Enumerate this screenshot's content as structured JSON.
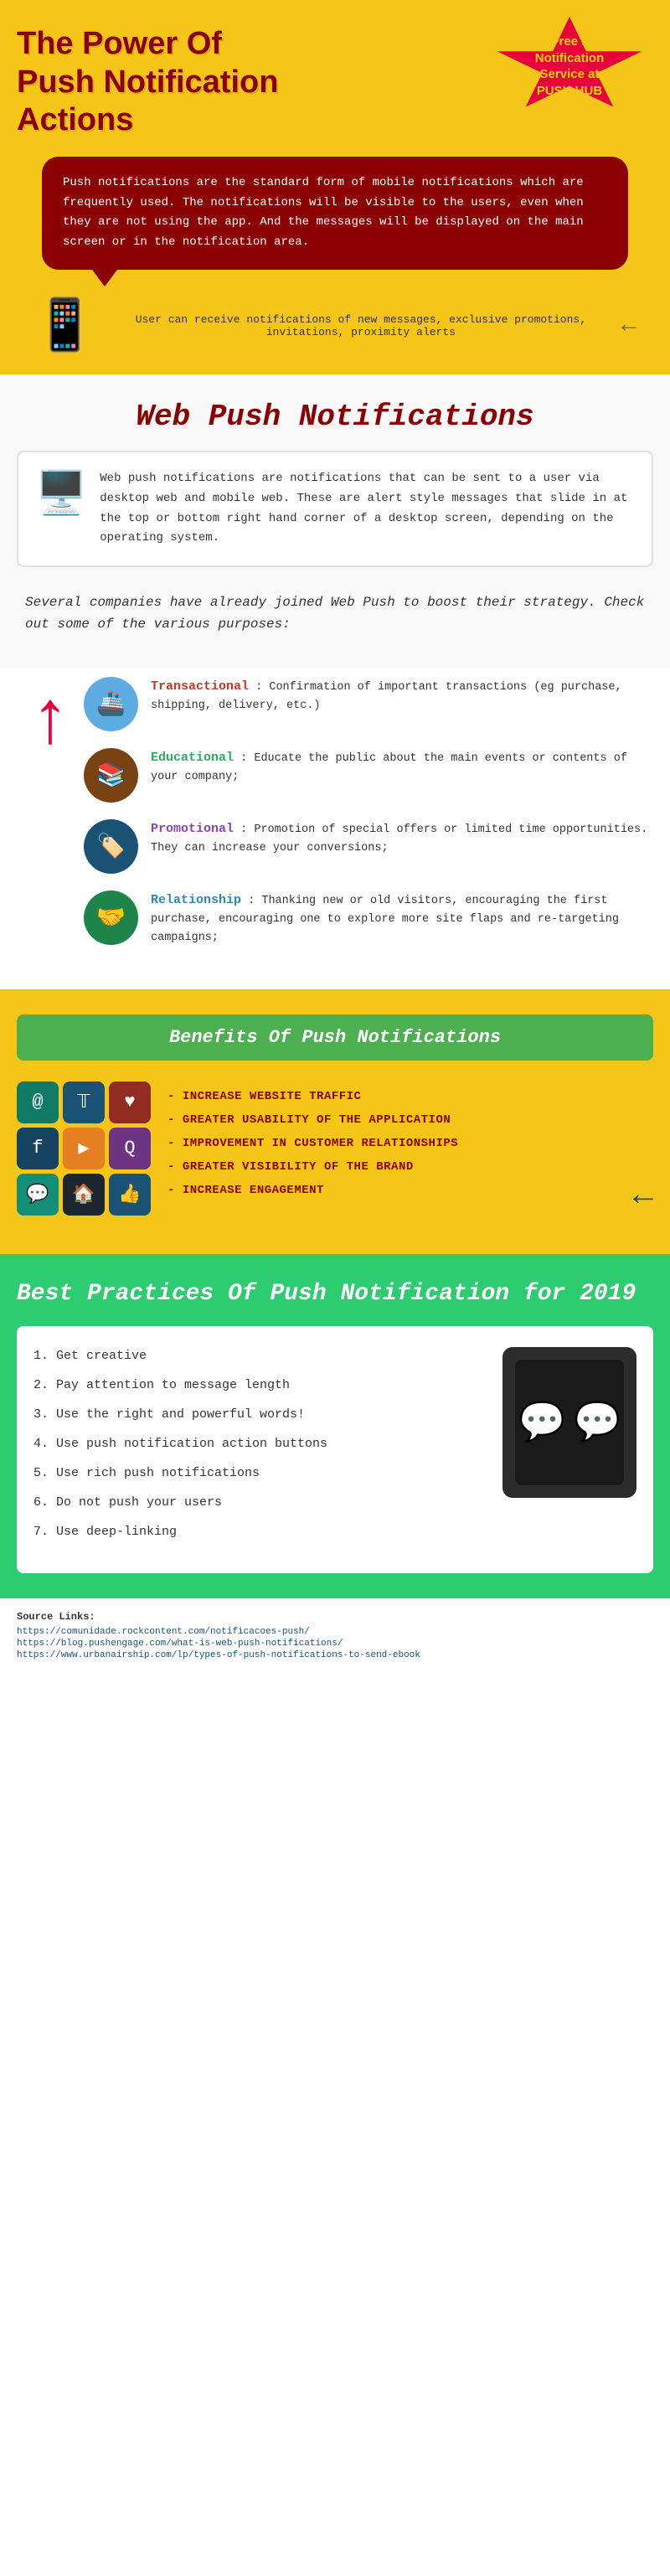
{
  "hero": {
    "title": "The Power Of Push Notification Actions",
    "starburst": {
      "line1": "Get Free Push",
      "line2": "Notification",
      "line3": "Service at",
      "line4": "PUSH HUB"
    },
    "bubble_text": "Push notifications are the standard form of mobile notifications which are frequently used. The notifications will be visible to the users, even when they are not using the app. And the messages will be displayed on the main screen or in the notification area.",
    "phone_caption": "User can receive notifications of new messages, exclusive promotions, invitations, proximity alerts"
  },
  "webpush": {
    "title": "Web Push Notifications",
    "description": "Web push notifications are notifications that can be sent to a user via desktop web and mobile web. These are alert style messages that slide in at the top or bottom right hand corner of a desktop screen, depending on the operating system.",
    "strategy_text": "Several companies have already joined Web Push to boost their strategy. Check out some of the various purposes:"
  },
  "purposes": [
    {
      "label": "Transactional",
      "label_color": "transactional",
      "text": ": Confirmation of important transactions (eg purchase, shipping, delivery, etc.)",
      "icon": "🚢"
    },
    {
      "label": "Educational",
      "label_color": "educational",
      "text": ": Educate the public about the main events or contents of your company;",
      "icon": "📚"
    },
    {
      "label": "Promotional",
      "label_color": "promotional",
      "text": ": Promotion of special offers or limited time opportunities. They can increase your conversions;",
      "icon": "🏷️"
    },
    {
      "label": "Relationship",
      "label_color": "relationship",
      "text": ": Thanking new or old visitors, encouraging the first purchase, encouraging one to explore more site flaps and re-targeting campaigns;",
      "icon": "🤝"
    }
  ],
  "benefits": {
    "title": "Benefits Of Push Notifications",
    "items": [
      "Increase Website Traffic",
      "Greater Usability Of The Application",
      "Improvement In Customer Relationships",
      "Greater Visibility Of The Brand",
      "Increase Engagement"
    ]
  },
  "practices": {
    "title": "Best Practices Of Push Notification for 2019",
    "items": [
      "1. Get creative",
      "2. Pay attention to message length",
      "3. Use the right and powerful words!",
      "4. Use push notification action buttons",
      "5. Use rich push notifications",
      "6. Do not push your users",
      "7. Use deep-linking"
    ]
  },
  "sources": {
    "title": "Source Links:",
    "links": [
      "https://comunidade.rockcontent.com/notificacoes-push/",
      "https://blog.pushengage.com/what-is-web-push-notifications/",
      "https://www.urbanairship.com/lp/types-of-push-notifications-to-send-ebook"
    ]
  }
}
